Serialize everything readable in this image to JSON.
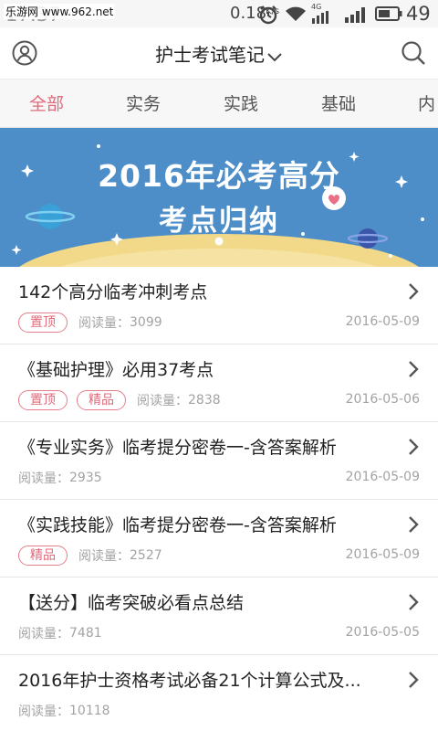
{
  "status_bar": {
    "time": "17:37",
    "watermark": "乐游网 www.962.net",
    "speed_value": "0.18",
    "speed_unit": "K/s",
    "network_label": "4G",
    "battery_percent": "49"
  },
  "header": {
    "title": "护士考试笔记",
    "avatar_icon": "user-circle-icon",
    "search_icon": "search-icon"
  },
  "tabs": [
    {
      "label": "全部",
      "active": true
    },
    {
      "label": "实务",
      "active": false
    },
    {
      "label": "实践",
      "active": false
    },
    {
      "label": "基础",
      "active": false
    },
    {
      "label": "内",
      "active": false
    }
  ],
  "banner": {
    "line1": "2016年必考高分",
    "line2": "考点归纳"
  },
  "read_prefix": "阅读量：",
  "articles": [
    {
      "title": "142个高分临考冲刺考点",
      "tags": [
        "置顶"
      ],
      "reads": "3099",
      "date": "2016-05-09"
    },
    {
      "title": "《基础护理》必用37考点",
      "tags": [
        "置顶",
        "精品"
      ],
      "reads": "2838",
      "date": "2016-05-06"
    },
    {
      "title": "《专业实务》临考提分密卷一-含答案解析",
      "tags": [],
      "reads": "2935",
      "date": "2016-05-09"
    },
    {
      "title": "《实践技能》临考提分密卷一-含答案解析",
      "tags": [
        "精品"
      ],
      "reads": "2527",
      "date": "2016-05-09"
    },
    {
      "title": "【送分】临考突破必看点总结",
      "tags": [],
      "reads": "7481",
      "date": "2016-05-05"
    },
    {
      "title": "2016年护士资格考试必备21个计算公式及...",
      "tags": [],
      "reads": "10118",
      "date": ""
    }
  ],
  "colors": {
    "accent": "#e06a7a",
    "banner_blue": "#4d8ec8",
    "meta_gray": "#a3a3a3"
  }
}
